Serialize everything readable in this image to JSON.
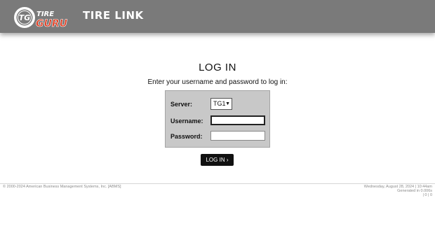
{
  "header": {
    "logo": {
      "circle_text": "TG",
      "word1": "TIRE",
      "word2": "GURU",
      "accent": "#e03a1e"
    },
    "app_title": "TIRE LINK"
  },
  "login": {
    "title": "LOG IN",
    "subtitle": "Enter your username and password to log in:",
    "server_label": "Server:",
    "server_value": "TG1",
    "username_label": "Username:",
    "username_value": "",
    "password_label": "Password:",
    "password_value": "",
    "submit_label": "LOG IN ›"
  },
  "footer": {
    "copyright": "© 2000-2024 American Business Management Systems, Inc. [ABMS]",
    "datetime": "Wednesday, August 28, 2024 | 10:44am",
    "generated": "Generated in 0.006s",
    "counter": "| 0 | 0"
  },
  "colors": {
    "header_bg": "#7a7a7a",
    "panel_bg": "#c8c8c8",
    "button_bg": "#111111"
  }
}
